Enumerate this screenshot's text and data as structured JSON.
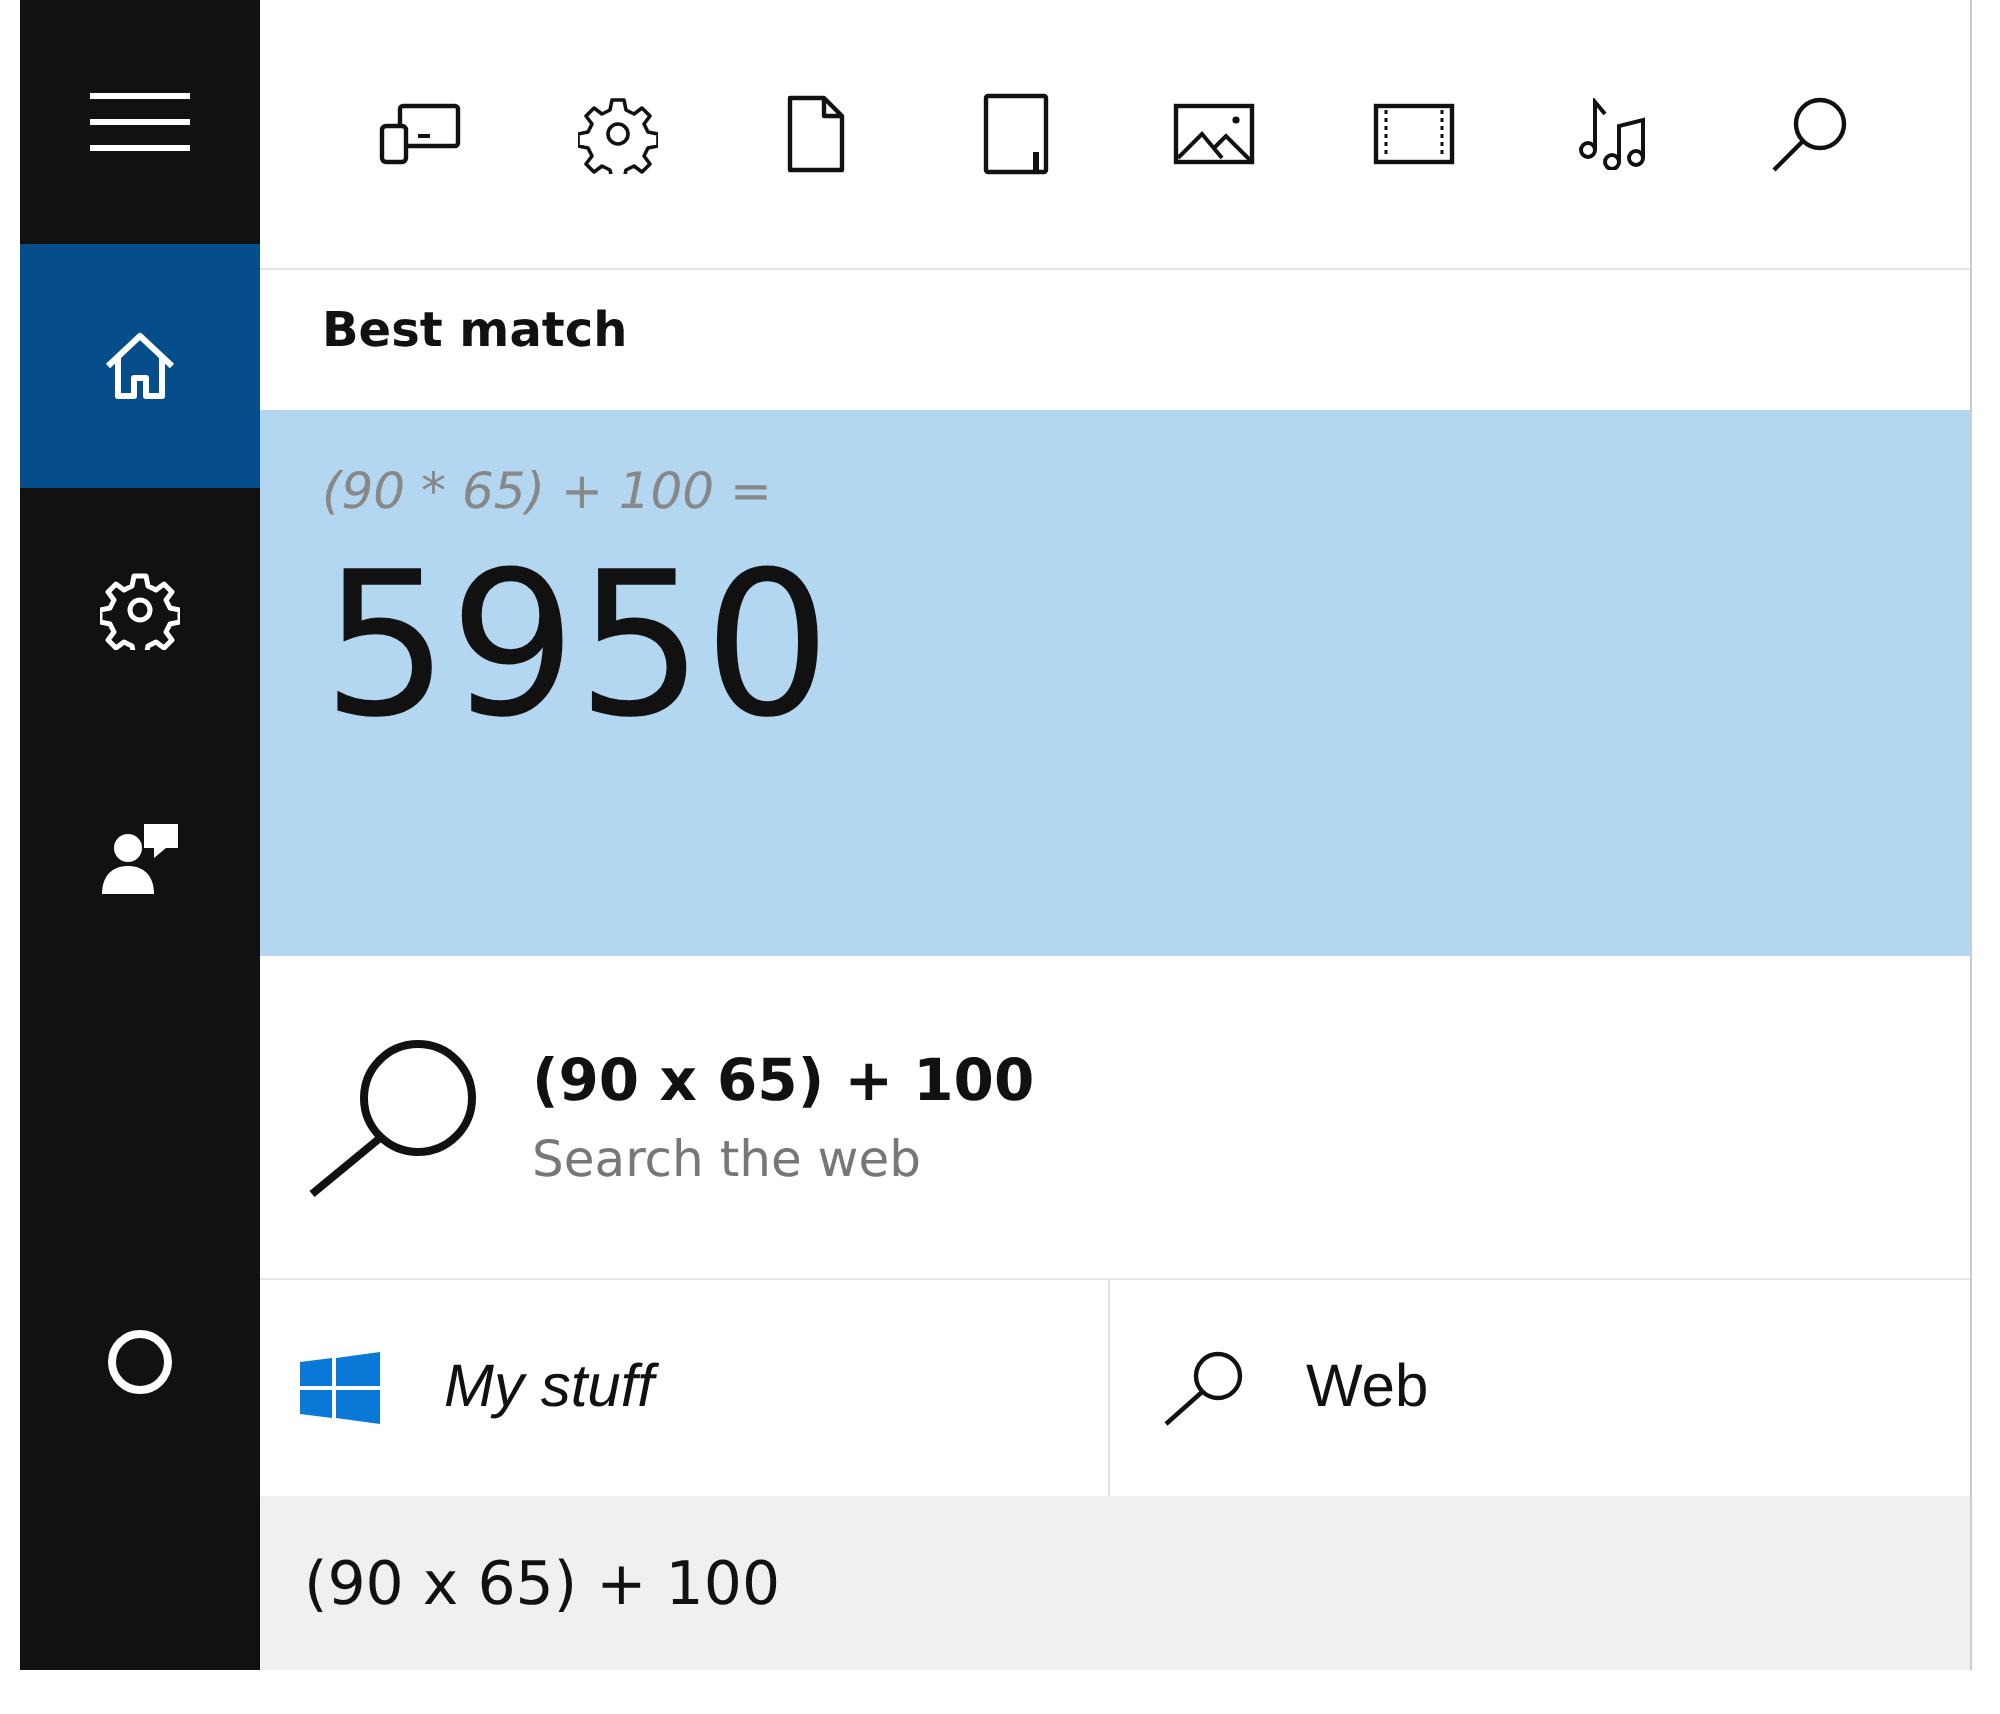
{
  "sidebar": {
    "items": [
      {
        "kind": "menu",
        "selected": false
      },
      {
        "kind": "home",
        "selected": true
      },
      {
        "kind": "settings",
        "selected": false
      },
      {
        "kind": "feedback",
        "selected": false
      },
      {
        "kind": "cortana",
        "selected": false
      }
    ]
  },
  "filters": [
    {
      "kind": "apps"
    },
    {
      "kind": "settings"
    },
    {
      "kind": "documents"
    },
    {
      "kind": "folders"
    },
    {
      "kind": "photos"
    },
    {
      "kind": "videos"
    },
    {
      "kind": "music"
    },
    {
      "kind": "web"
    }
  ],
  "best_match": {
    "heading": "Best match",
    "expression": "(90 * 65) + 100 =",
    "result": "5950"
  },
  "web_suggestion": {
    "title": "(90 x 65) + 100",
    "subtitle": "Search the web"
  },
  "scopes": [
    {
      "kind": "my_stuff",
      "label": "My stuff"
    },
    {
      "kind": "web",
      "label": "Web"
    }
  ],
  "search_box": {
    "value": "(90 x 65) + 100"
  }
}
